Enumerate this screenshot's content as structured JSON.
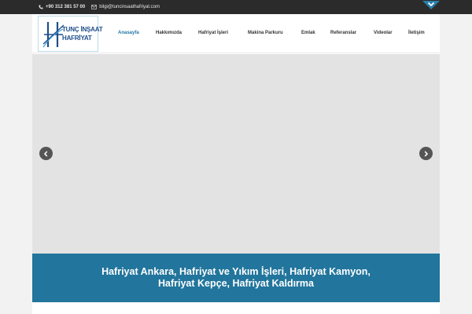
{
  "topbar": {
    "phone": "+90 312 381 57 00",
    "email": "bilgi@tuncinsaathafriyat.com",
    "phone_icon": "phone-icon",
    "email_icon": "envelope-icon"
  },
  "logo": {
    "line1": "TUNÇ İNŞAAT",
    "line2": "HAFRİYAT"
  },
  "nav": {
    "items": [
      {
        "label": "Anasayfa",
        "active": true
      },
      {
        "label": "Hakkımızda"
      },
      {
        "label": "Hafriyat İşleri"
      },
      {
        "label": "Makina Parkuru"
      },
      {
        "label": "Emlak"
      },
      {
        "label": "Referanslar"
      },
      {
        "label": "Videolar"
      },
      {
        "label": "İletişim"
      }
    ]
  },
  "slider": {
    "prev_icon": "chevron-left-icon",
    "next_icon": "chevron-right-icon"
  },
  "tagline": {
    "text": "Hafriyat Ankara, Hafriyat ve Yıkım İşleri, Hafriyat Kamyon, Hafriyat Kepçe, Hafriyat Kaldırma"
  },
  "colors": {
    "topbar_bg": "#2b2b2b",
    "accent": "#22759c",
    "active_nav": "#2278a3",
    "slider_bg": "#e3e3e3"
  }
}
